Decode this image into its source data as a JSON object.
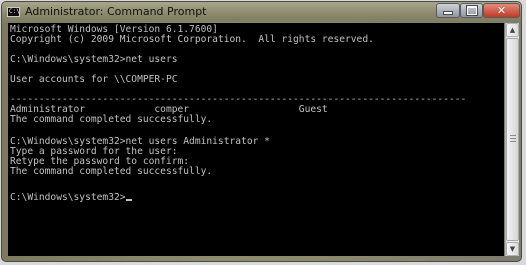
{
  "window": {
    "title": "Administrator: Command Prompt",
    "icon": "cmd-icon",
    "icon_glyph": "C:\\"
  },
  "controls": {
    "minimize_icon": "minimize-icon",
    "maximize_icon": "maximize-icon",
    "close_icon": "close-icon",
    "close_glyph": "✕"
  },
  "console": {
    "lines": [
      "Microsoft Windows [Version 6.1.7600]",
      "Copyright (c) 2009 Microsoft Corporation.  All rights reserved.",
      "",
      "C:\\Windows\\system32>net users",
      "",
      "User accounts for \\\\COMPER-PC",
      "",
      "-------------------------------------------------------------------------------",
      "Administrator            comper                   Guest",
      "The command completed successfully.",
      "",
      "",
      "C:\\Windows\\system32>net users Administrator *",
      "Type a password for the user:",
      "Retype the password to confirm:",
      "The command completed successfully.",
      "",
      "",
      "C:\\Windows\\system32>"
    ],
    "colors": {
      "background": "#000000",
      "text": "#c0c0c0"
    }
  },
  "scrollbar": {
    "up_arrow": "▲",
    "down_arrow": "▼"
  }
}
